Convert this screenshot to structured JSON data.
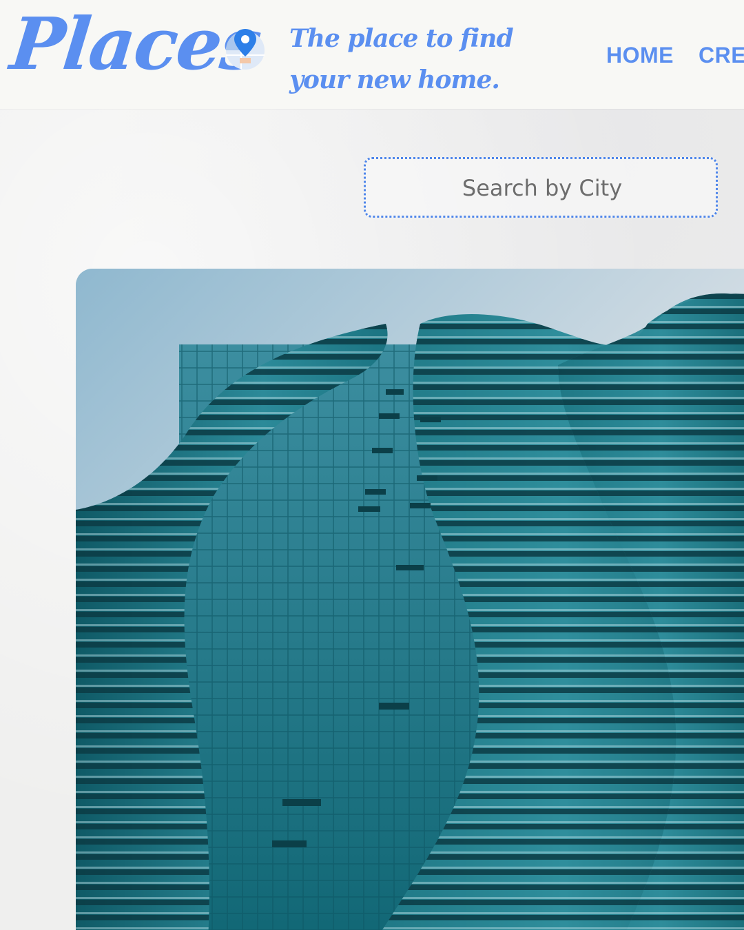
{
  "brand": {
    "logo_text": "Places",
    "tagline_line1": "The place to find",
    "tagline_line2": "your new home."
  },
  "nav": {
    "items": [
      {
        "label": "HOME"
      },
      {
        "label": "CREATE"
      }
    ]
  },
  "search": {
    "placeholder": "Search by City",
    "value": ""
  },
  "hero": {
    "icon": "pin-icon"
  },
  "colors": {
    "accent": "#5b8ff0",
    "search_border": "#4f86ea",
    "header_bg": "#f8f8f5",
    "building_teal": "#1a7381"
  }
}
